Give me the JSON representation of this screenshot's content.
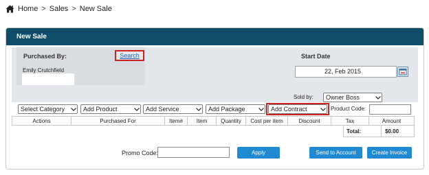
{
  "breadcrumb": {
    "items": [
      "Home",
      "Sales",
      "New Sale"
    ],
    "separator": ">"
  },
  "panel": {
    "title": "New Sale"
  },
  "purchased_by": {
    "label": "Purchased By:",
    "search_link": "Search",
    "customer_name": "Emily Crutchfield"
  },
  "start_date": {
    "label": "Start Date",
    "value": "22, Feb 2015"
  },
  "sold_by": {
    "label": "Sold by:",
    "value": "Owner Boss"
  },
  "selects": {
    "category": "Select Category",
    "product": "Add Product",
    "service": "Add Service",
    "package": "Add Package",
    "contract": "Add Contract"
  },
  "product_code": {
    "label": "Product Code:",
    "value": ""
  },
  "table": {
    "columns": [
      "Actions",
      "Purchased For",
      "Item#",
      "Item",
      "Quantity",
      "Cost per item",
      "Discount",
      "Tax",
      "Amount"
    ],
    "total_label": "Total:",
    "total_value": "$0.00"
  },
  "promo": {
    "label": "Promo Code:",
    "value": ""
  },
  "buttons": {
    "apply": "Apply",
    "send_to_account": "Send to Account",
    "create_invoice": "Create Invoice"
  },
  "colors": {
    "header_bar": "#0e4e68",
    "button_blue": "#1f8ad1",
    "highlight_red": "#cc2222",
    "link_blue": "#1d5fb8"
  },
  "icons": {
    "home": "home-icon",
    "calendar": "calendar-icon",
    "dropdown": "chevron-down-icon"
  }
}
